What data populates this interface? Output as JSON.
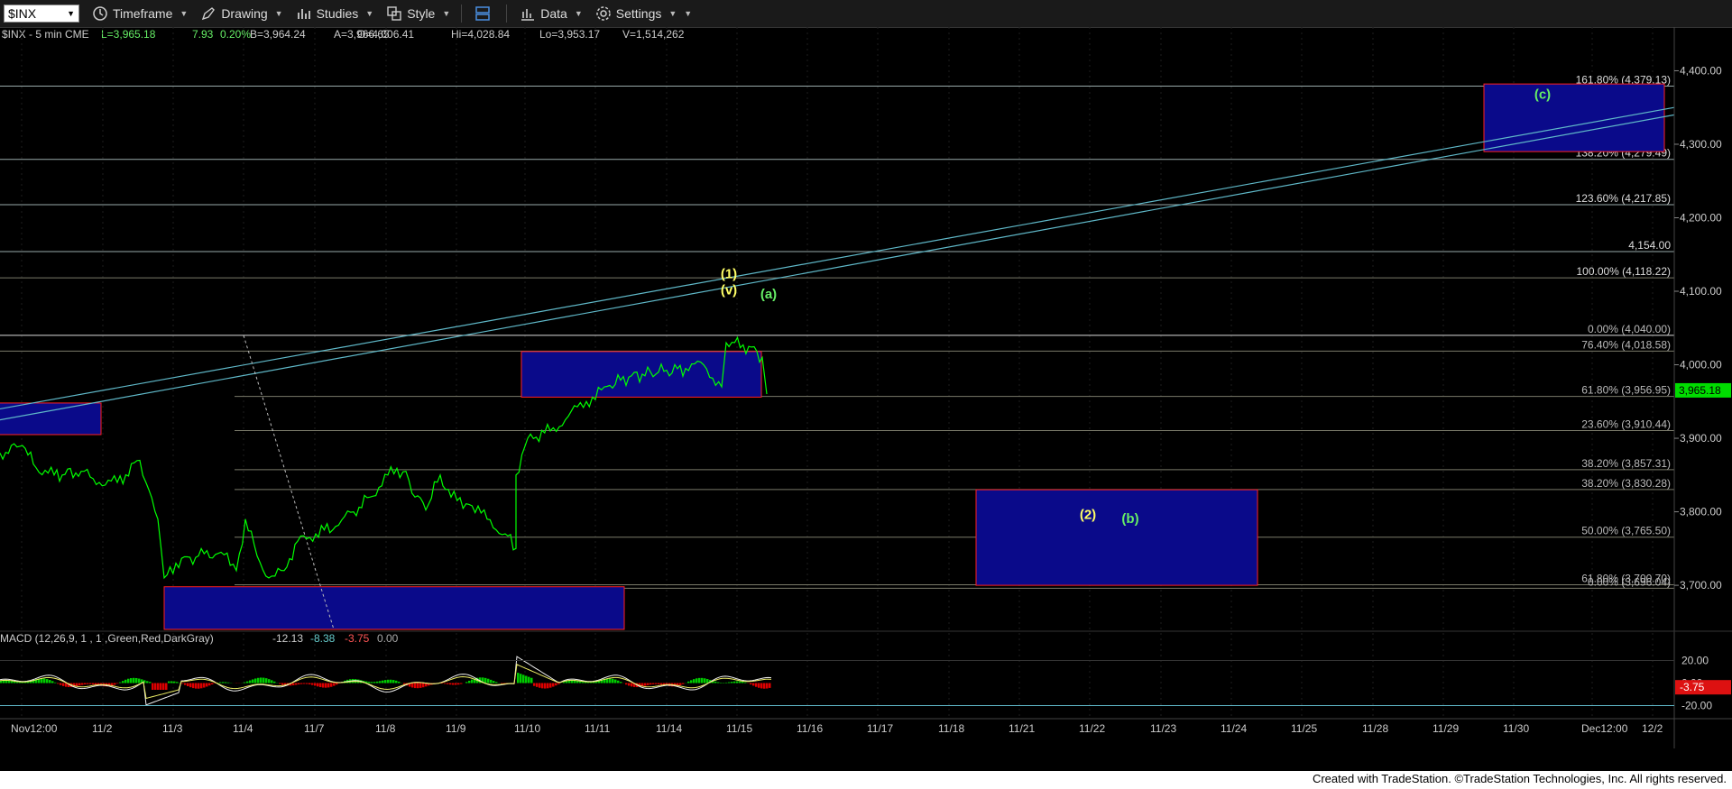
{
  "toolbar": {
    "symbol": "$INX",
    "timeframe_label": "Timeframe",
    "drawing_label": "Drawing",
    "studies_label": "Studies",
    "style_label": "Style",
    "data_label": "Data",
    "settings_label": "Settings"
  },
  "header": {
    "instrument": "$INX - 5 min  CME",
    "last": "L=3,965.18",
    "change": "7.93",
    "pct": "0.20%",
    "bid": "B=3,964.24",
    "ask": "A=3,966.65",
    "open": "O=4,006.41",
    "high": "Hi=4,028.84",
    "low": "Lo=3,953.17",
    "volume": "V=1,514,262"
  },
  "macd_header": {
    "label": "MACD (12,26,9, 1 , 1 ,Green,Red,DarkGray)",
    "v1": "-12.13",
    "v2": "-8.38",
    "v3": "-3.75",
    "v4": "0.00"
  },
  "footer": "Created with TradeStation. ©TradeStation Technologies, Inc. All rights reserved.",
  "colors": {
    "price": "#00ff00",
    "fib": "#888888",
    "box": "#0a0a8a",
    "box_border": "#ff2020",
    "trend": "#5fb8c8",
    "label_yellow": "#ffff66",
    "label_green": "#66ee66"
  },
  "chart_data": {
    "type": "line",
    "y_range": [
      3640,
      4430
    ],
    "y_ticks": [
      "4,400.00",
      "4,300.00",
      "4,200.00",
      "4,100.00",
      "4,000.00",
      "3,900.00",
      "3,800.00",
      "3,700.00"
    ],
    "y_tick_values": [
      4400,
      4300,
      4200,
      4100,
      4000,
      3900,
      3800,
      3700
    ],
    "last_price_label": "3,965.18",
    "last_price": 3965.18,
    "x_labels": [
      "Nov12:00",
      "11/2",
      "11/3",
      "11/4",
      "11/7",
      "11/8",
      "11/9",
      "11/10",
      "11/11",
      "11/14",
      "11/15",
      "11/16",
      "11/17",
      "11/18",
      "11/21",
      "11/22",
      "11/23",
      "11/24",
      "11/25",
      "11/28",
      "11/29",
      "11/30",
      "Dec12:00",
      "12/2"
    ],
    "fib_levels": [
      {
        "label": "161.80% (4,379.13)",
        "value": 4379.13
      },
      {
        "label": "138.20% (4,279.49)",
        "value": 4279.49
      },
      {
        "label": "123.60% (4,217.85)",
        "value": 4217.85
      },
      {
        "label": "4,154.00",
        "value": 4154.0
      },
      {
        "label": "100.00% (4,118.22)",
        "value": 4118.22
      },
      {
        "label": "0.00% (4,040.00)",
        "value": 4040.0
      },
      {
        "label": "76.40% (4,018.58)",
        "value": 4018.58
      },
      {
        "label": "61.80% (3,956.95)",
        "value": 3956.95
      },
      {
        "label": "23.60% (3,910.44)",
        "value": 3910.44
      },
      {
        "label": "38.20% (3,857.31)",
        "value": 3857.31
      },
      {
        "label": "38.20% (3,830.28)",
        "value": 3830.28
      },
      {
        "label": "50.00% (3,765.50)",
        "value": 3765.5
      },
      {
        "label": "61.80% (3,700.70)",
        "value": 3700.7
      },
      {
        "label": "0.00% (3,696.04)",
        "value": 3696.04
      }
    ],
    "wave_labels": [
      {
        "text": "(1)",
        "color": "yellow"
      },
      {
        "text": "(v)",
        "color": "yellow"
      },
      {
        "text": "(a)",
        "color": "green"
      },
      {
        "text": "(2)",
        "color": "yellow"
      },
      {
        "text": "(b)",
        "color": "green"
      },
      {
        "text": "(c)",
        "color": "green"
      }
    ],
    "macd": {
      "y_ticks": [
        "20.00",
        "0.00",
        "-20.00"
      ],
      "y_tick_values": [
        20,
        0,
        -20
      ],
      "y_range": [
        -30,
        30
      ],
      "last_label": "-3.75"
    }
  }
}
